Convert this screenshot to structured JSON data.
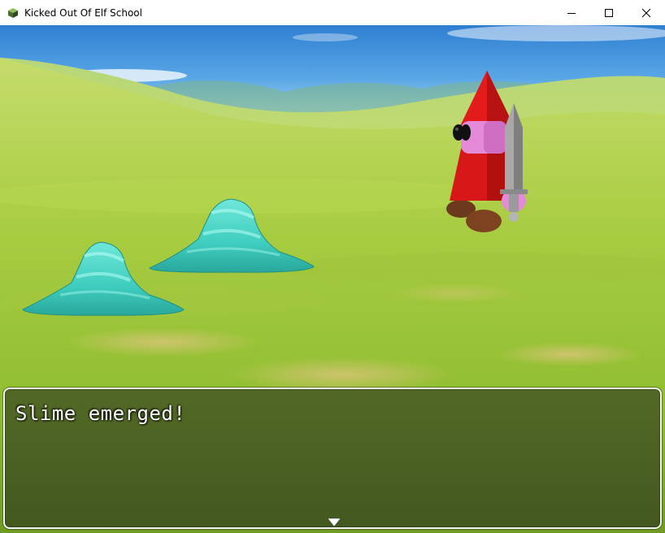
{
  "window": {
    "title": "Kicked Out Of Elf School",
    "icon": "rpg-maker-cube-icon",
    "controls": [
      "minimize-icon",
      "maximize-icon",
      "close-icon"
    ]
  },
  "battle": {
    "enemies": [
      {
        "name": "slime",
        "color": "#3fd0c0"
      },
      {
        "name": "slime",
        "color": "#3fd0c0"
      }
    ],
    "player": {
      "name": "elf",
      "hat_color": "#d81818",
      "skin_color": "#e58ad8",
      "weapon": "sword-icon"
    }
  },
  "message": {
    "text": "Slime emerged!",
    "continue_icon": "down-triangle-icon"
  },
  "colors": {
    "sky": "#3d8fd8",
    "grass": "#a5cc3c",
    "slime": "#3fd0c0",
    "message_border": "#f4f4f4"
  }
}
